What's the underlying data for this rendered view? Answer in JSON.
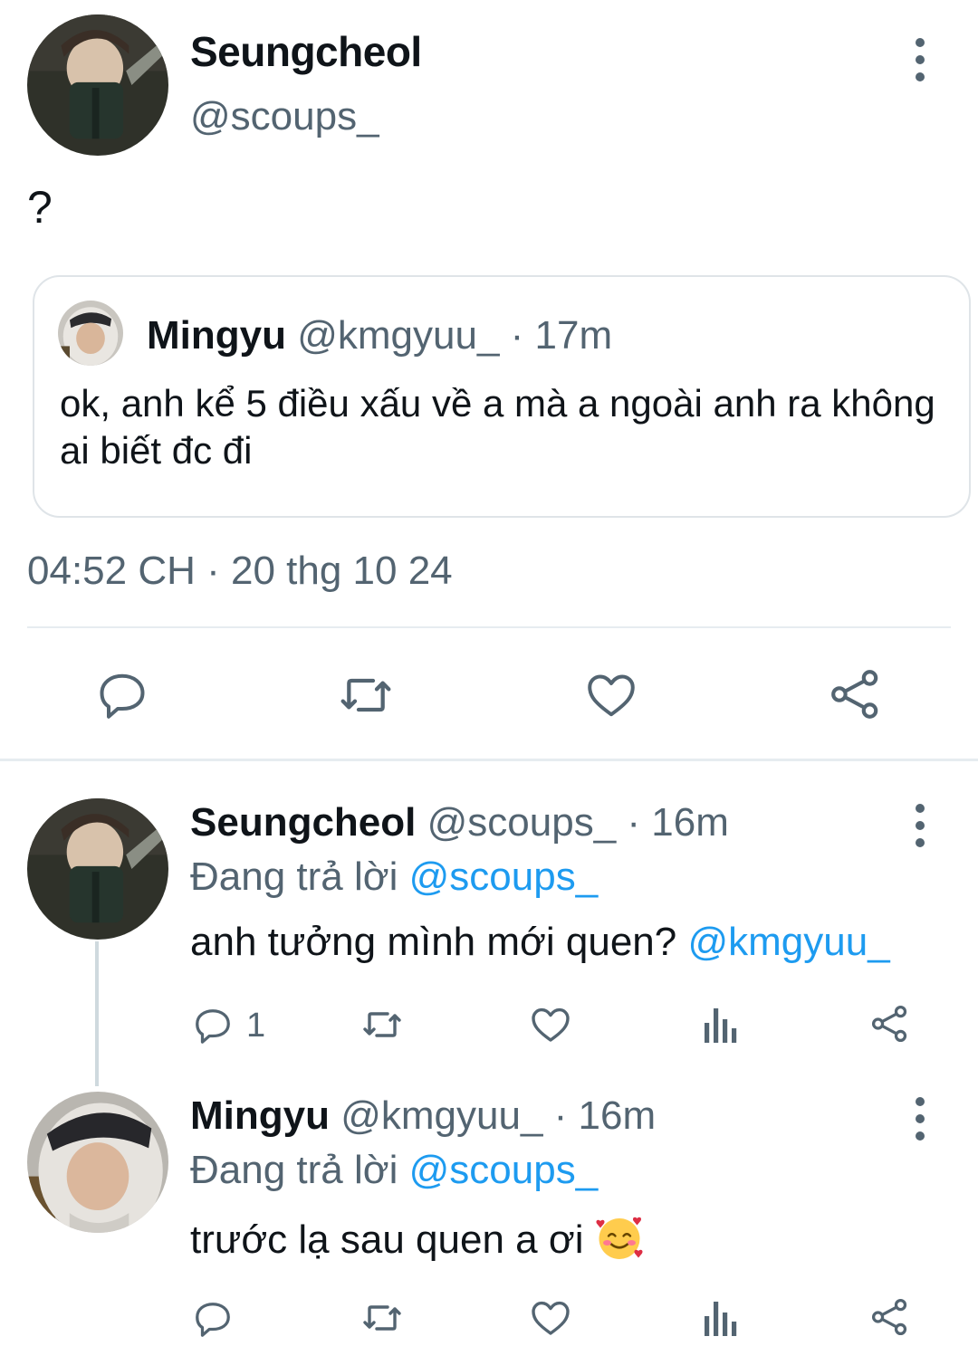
{
  "main_tweet": {
    "name": "Seungcheol",
    "handle": "@scoups_",
    "text": "?",
    "quote": {
      "name": "Mingyu",
      "meta": "@kmgyuu_ · 17m",
      "text": "ok, anh kể 5 điều xấu về a mà a ngoài anh ra không ai biết đc đi"
    },
    "timestamp": "04:52 CH · 20 thg 10 24"
  },
  "actions": {
    "icons": [
      "reply-icon",
      "retweet-icon",
      "like-icon",
      "share-icon"
    ]
  },
  "replies": [
    {
      "name": "Seungcheol",
      "meta": "@scoups_ · 16m",
      "replying_label": "Đang trả lời",
      "replying_to": "@scoups_",
      "text": "anh tưởng mình mới quen?",
      "mention": "@kmgyuu_",
      "reply_count": "1"
    },
    {
      "name": "Mingyu",
      "meta": "@kmgyuu_ · 16m",
      "replying_label": "Đang trả lời",
      "replying_to": "@scoups_",
      "text": "trước lạ sau quen a ơi",
      "emoji": "smiling-face-with-hearts"
    }
  ],
  "colors": {
    "text": "#0f1419",
    "secondary": "#536471",
    "accent": "#1d9bf0",
    "border": "#dfe4e8"
  }
}
